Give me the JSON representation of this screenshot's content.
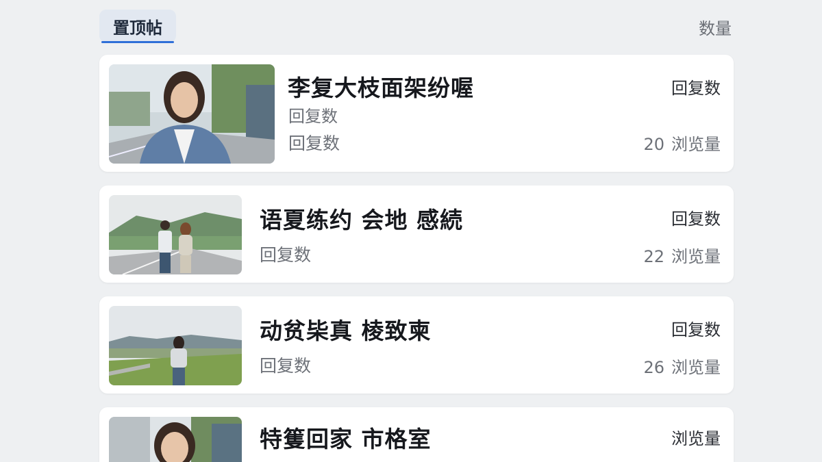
{
  "header": {
    "tab_pinned": "置顶帖",
    "right_label": "数量"
  },
  "posts": [
    {
      "title": "李复大枝面架纷喔",
      "subtitle": "回复数",
      "meta": "回复数",
      "right_top": "回复数",
      "views_count": "20",
      "views_label": "浏览量"
    },
    {
      "title": "语夏练约  会地 感続",
      "meta": "回复数",
      "right_top": "回复数",
      "views_count": "22",
      "views_label": "浏览量"
    },
    {
      "title": "动贫枈真 棱致柬",
      "meta": "回复数",
      "right_top": "回复数",
      "views_count": "26",
      "views_label": "浏览量"
    },
    {
      "title": "特篗回家 市格室",
      "right_top": "浏览量"
    }
  ],
  "colors": {
    "background": "#eef0f2",
    "card": "#ffffff",
    "tab_active_bg": "#e2e8f1",
    "tab_underline": "#2f6fd8"
  }
}
